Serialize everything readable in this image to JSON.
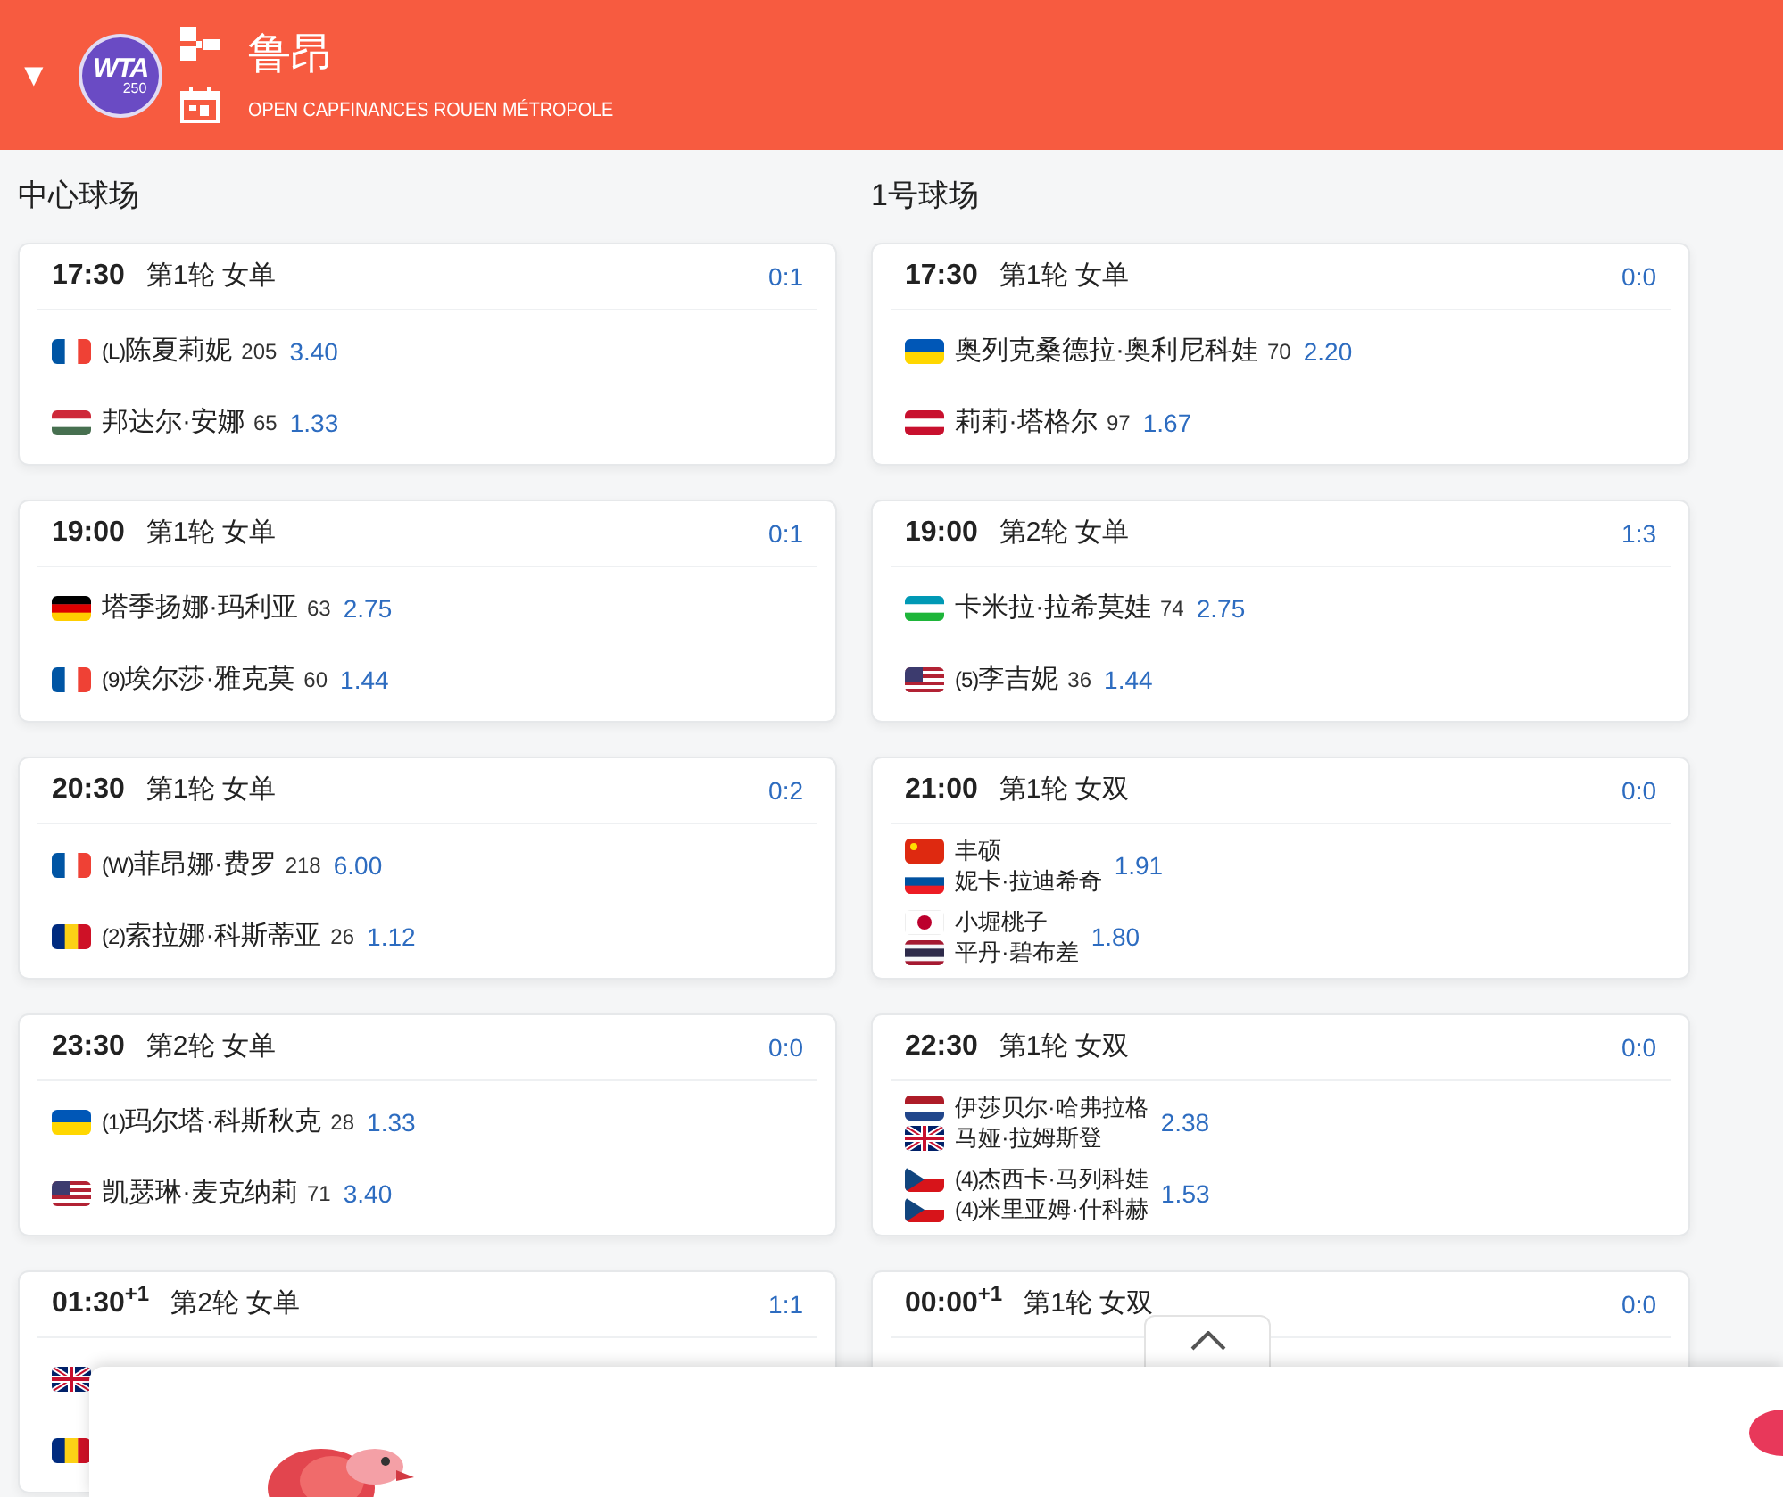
{
  "header": {
    "toggle": "▼",
    "logo": {
      "text": "WTA",
      "tier": "250"
    },
    "title": "鲁昂",
    "subtitle": "OPEN CAPFINANCES ROUEN MÉTROPOLE"
  },
  "courts": [
    {
      "name": "中心球场",
      "matches": [
        {
          "time": "17:30",
          "round": "第1轮 女单",
          "score": "0:1",
          "sides": [
            {
              "players": [
                {
                  "kind": "fr",
                  "seed": "(L)",
                  "name": "陈夏莉妮"
                }
              ],
              "rank": "205",
              "odds": "3.40"
            },
            {
              "players": [
                {
                  "kind": "hu",
                  "name": "邦达尔·安娜"
                }
              ],
              "rank": "65",
              "odds": "1.33"
            }
          ]
        },
        {
          "time": "19:00",
          "round": "第1轮 女单",
          "score": "0:1",
          "sides": [
            {
              "players": [
                {
                  "kind": "de",
                  "name": "塔季扬娜·玛利亚"
                }
              ],
              "rank": "63",
              "odds": "2.75"
            },
            {
              "players": [
                {
                  "kind": "fr",
                  "seed": "(9)",
                  "name": "埃尔莎·雅克莫"
                }
              ],
              "rank": "60",
              "odds": "1.44"
            }
          ]
        },
        {
          "time": "20:30",
          "round": "第1轮 女单",
          "score": "0:2",
          "sides": [
            {
              "players": [
                {
                  "kind": "fr",
                  "seed": "(W)",
                  "name": "菲昂娜·费罗"
                }
              ],
              "rank": "218",
              "odds": "6.00"
            },
            {
              "players": [
                {
                  "kind": "ro",
                  "seed": "(2)",
                  "name": "索拉娜·科斯蒂亚"
                }
              ],
              "rank": "26",
              "odds": "1.12"
            }
          ]
        },
        {
          "time": "23:30",
          "round": "第2轮 女单",
          "score": "0:0",
          "sides": [
            {
              "players": [
                {
                  "kind": "ua",
                  "seed": "(1)",
                  "name": "玛尔塔·科斯秋克"
                }
              ],
              "rank": "28",
              "odds": "1.33"
            },
            {
              "players": [
                {
                  "kind": "us",
                  "name": "凯瑟琳·麦克纳莉"
                }
              ],
              "rank": "71",
              "odds": "3.40"
            }
          ]
        },
        {
          "time": "01:30$^{+1}$",
          "round": "第2轮 女单",
          "score": "1:1",
          "sides": [
            {
              "players": [
                {
                  "kind": "gb"
                }
              ]
            },
            {
              "players": [
                {
                  "kind": "ro"
                }
              ]
            }
          ]
        }
      ]
    },
    {
      "name": "1号球场",
      "matches": [
        {
          "time": "17:30",
          "round": "第1轮 女单",
          "score": "0:0",
          "sides": [
            {
              "players": [
                {
                  "kind": "ua",
                  "name": "奥列克桑德拉·奥利尼科娃"
                }
              ],
              "rank": "70",
              "odds": "2.20"
            },
            {
              "players": [
                {
                  "kind": "at",
                  "name": "莉莉·塔格尔"
                }
              ],
              "rank": "97",
              "odds": "1.67"
            }
          ]
        },
        {
          "time": "19:00",
          "round": "第2轮 女单",
          "score": "1:3",
          "sides": [
            {
              "players": [
                {
                  "kind": "uz",
                  "name": "卡米拉·拉希莫娃"
                }
              ],
              "rank": "74",
              "odds": "2.75"
            },
            {
              "players": [
                {
                  "kind": "us",
                  "seed": "(5)",
                  "name": "李吉妮"
                }
              ],
              "rank": "36",
              "odds": "1.44"
            }
          ]
        },
        {
          "time": "21:00",
          "round": "第1轮 女双",
          "score": "0:0",
          "sides": [
            {
              "players": [
                {
                  "kind": "cn",
                  "name": "丰硕"
                },
                {
                  "kind": "si",
                  "name": "妮卡·拉迪希奇"
                }
              ],
              "odds": "1.91"
            },
            {
              "players": [
                {
                  "kind": "jp",
                  "name": "小堀桃子"
                },
                {
                  "kind": "th",
                  "name": "平丹·碧布差"
                }
              ],
              "odds": "1.80"
            }
          ]
        },
        {
          "time": "22:30",
          "round": "第1轮 女双",
          "score": "0:0",
          "sides": [
            {
              "players": [
                {
                  "kind": "nl",
                  "name": "伊莎贝尔·哈弗拉格"
                },
                {
                  "kind": "gb",
                  "name": "马娅·拉姆斯登"
                }
              ],
              "odds": "2.38"
            },
            {
              "players": [
                {
                  "kind": "cz",
                  "seed": "(4)",
                  "name": "杰西卡·马列科娃"
                },
                {
                  "kind": "cz",
                  "seed": "(4)",
                  "name": "米里亚姆·什科赫"
                }
              ],
              "odds": "1.53"
            }
          ]
        },
        {
          "time": "00:00$^{+1}$",
          "round": "第1轮 女双",
          "score": "0:0"
        }
      ]
    }
  ],
  "banner": {
    "kind": "promo"
  }
}
